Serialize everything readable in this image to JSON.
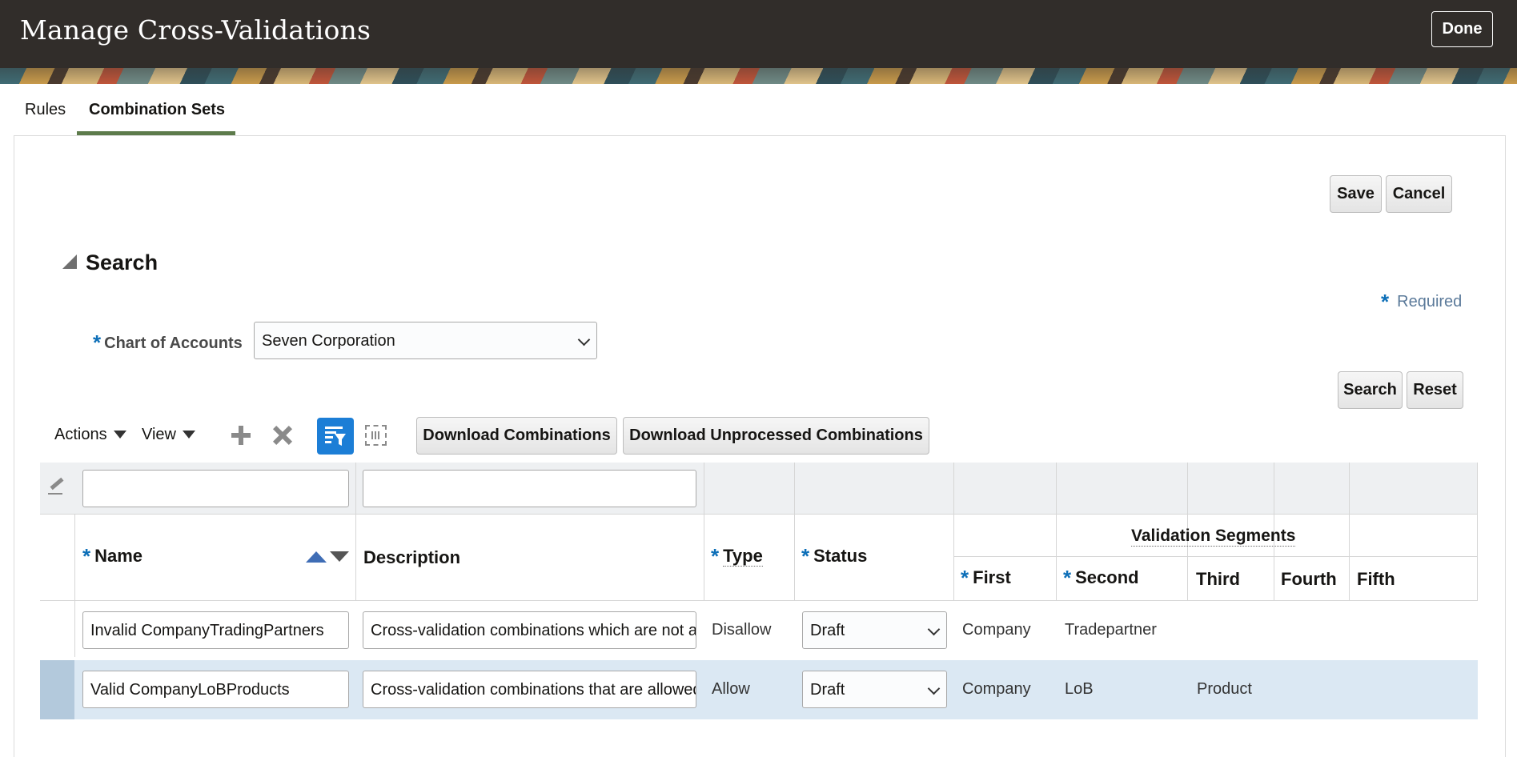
{
  "header": {
    "title": "Manage Cross-Validations",
    "done_label": "Done"
  },
  "tabs": [
    {
      "label": "Rules",
      "selected": false
    },
    {
      "label": "Combination Sets",
      "selected": true
    }
  ],
  "actions": {
    "save_label": "Save",
    "cancel_label": "Cancel"
  },
  "search": {
    "title": "Search",
    "required_label": "Required",
    "required_marker": "*",
    "chart_of_accounts": {
      "label": "Chart of Accounts",
      "value": "Seven Corporation"
    },
    "search_label": "Search",
    "reset_label": "Reset"
  },
  "toolbar": {
    "actions_label": "Actions",
    "view_label": "View",
    "icons": [
      "add-icon",
      "delete-icon",
      "query-by-example-icon",
      "detach-icon"
    ],
    "download_combinations_label": "Download Combinations",
    "download_unprocessed_label": "Download Unprocessed Combinations"
  },
  "table": {
    "columns": {
      "name": "Name",
      "description": "Description",
      "type": "Type",
      "status": "Status",
      "group": "Validation Segments",
      "first": "First",
      "second": "Second",
      "third": "Third",
      "fourth": "Fourth",
      "fifth": "Fifth"
    },
    "rows": [
      {
        "name": "Invalid CompanyTradingPartners",
        "description": "Cross-validation combinations which are not allowed",
        "type": "Disallow",
        "status": "Draft",
        "first": "Company",
        "second": "Tradepartner",
        "third": "",
        "fourth": "",
        "fifth": "",
        "selected": false
      },
      {
        "name": "Valid CompanyLoBProducts",
        "description": "Cross-validation combinations that are allowed",
        "type": "Allow",
        "status": "Draft",
        "first": "Company",
        "second": "LoB",
        "third": "Product",
        "fourth": "",
        "fifth": "",
        "selected": true
      }
    ]
  },
  "colors": {
    "header_bg": "#312d2a",
    "tab_accent": "#5d7b4b",
    "required_star": "#0d6fb8",
    "selected_row": "#dbe8f3"
  }
}
